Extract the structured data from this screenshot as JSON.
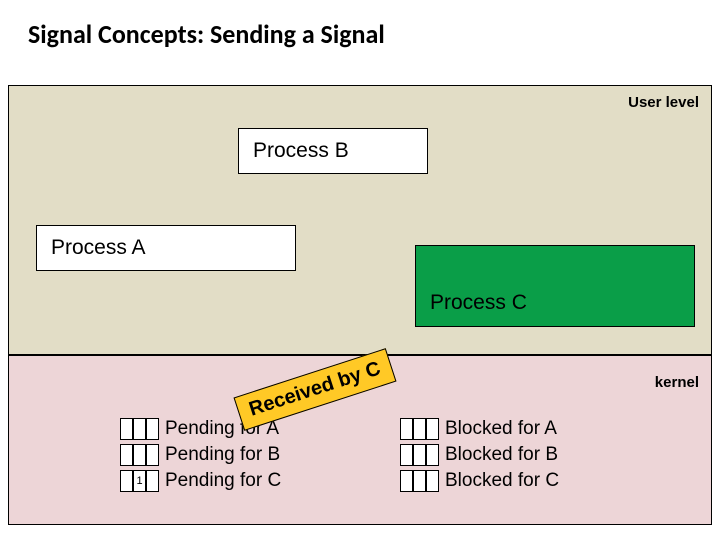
{
  "title": "Signal Concepts: Sending a Signal",
  "areas": {
    "user_label": "User level",
    "kernel_label": "kernel"
  },
  "processes": {
    "a": "Process A",
    "b": "Process B",
    "c": "Process C"
  },
  "pending": {
    "a": "Pending for A",
    "b": "Pending for B",
    "c": "Pending for C",
    "c_bit": "1"
  },
  "blocked": {
    "a": "Blocked for A",
    "b": "Blocked for B",
    "c": "Blocked for C"
  },
  "received_label": "Received by C"
}
